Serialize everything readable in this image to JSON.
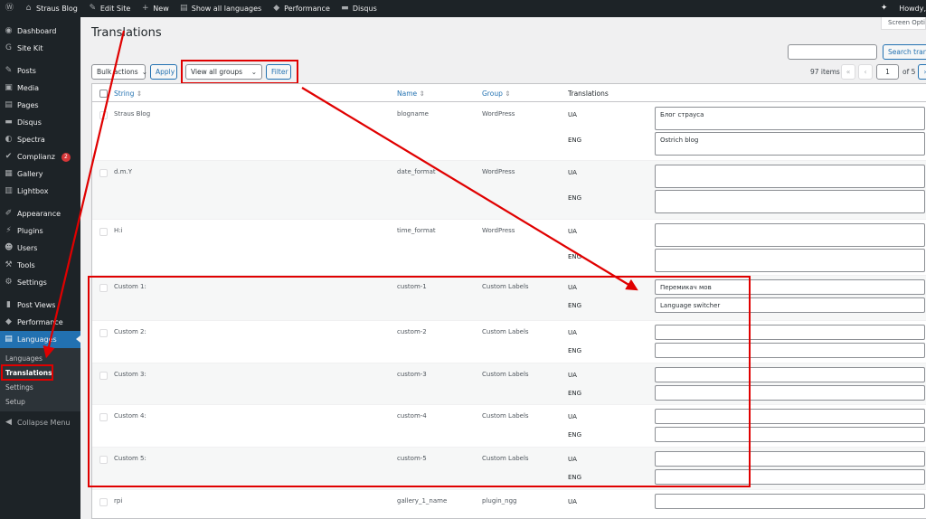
{
  "admin_bar": {
    "site_name": "Straus Blog",
    "edit_site": "Edit Site",
    "new": "New",
    "show_all_languages": "Show all languages",
    "performance": "Performance",
    "disqus": "Disqus",
    "howdy": "Howdy,"
  },
  "screen_options": "Screen Options",
  "sidebar": {
    "items": [
      {
        "label": "Dashboard",
        "icon": "dashboard-icon"
      },
      {
        "label": "Site Kit",
        "icon": "sitekit-icon"
      },
      {
        "label": "Posts",
        "icon": "pin-icon"
      },
      {
        "label": "Media",
        "icon": "media-icon"
      },
      {
        "label": "Pages",
        "icon": "page-icon"
      },
      {
        "label": "Disqus",
        "icon": "comment-icon"
      },
      {
        "label": "Spectra",
        "icon": "spectra-icon"
      },
      {
        "label": "Complianz",
        "icon": "check-icon",
        "badge": "2"
      },
      {
        "label": "Gallery",
        "icon": "gallery-icon"
      },
      {
        "label": "Lightbox",
        "icon": "lightbox-icon"
      },
      {
        "label": "Appearance",
        "icon": "brush-icon"
      },
      {
        "label": "Plugins",
        "icon": "plugin-icon"
      },
      {
        "label": "Users",
        "icon": "users-icon"
      },
      {
        "label": "Tools",
        "icon": "wrench-icon"
      },
      {
        "label": "Settings",
        "icon": "settings-icon"
      },
      {
        "label": "Post Views",
        "icon": "chart-icon"
      },
      {
        "label": "Performance",
        "icon": "performance-icon"
      },
      {
        "label": "Languages",
        "icon": "translate-icon"
      }
    ],
    "submenu": [
      "Languages",
      "Translations",
      "Settings",
      "Setup"
    ],
    "collapse": "Collapse Menu"
  },
  "page": {
    "title": "Translations",
    "search_button": "Search translations",
    "bulk_actions": "Bulk actions",
    "apply": "Apply",
    "groups_select": "View all groups",
    "filter": "Filter",
    "items_count": "97 items",
    "first_page": "«",
    "prev_page": "‹",
    "current_page": "1",
    "of_pages": "of 5",
    "next_page": "›"
  },
  "table": {
    "columns": {
      "string": "String",
      "name": "Name",
      "group": "Group",
      "translations": "Translations"
    },
    "rows": [
      {
        "string": "Straus Blog",
        "name": "blogname",
        "group": "WordPress",
        "ua": "Блог страуса",
        "eng": "Ostrich blog"
      },
      {
        "string": "d.m.Y",
        "name": "date_format",
        "group": "WordPress",
        "ua": "",
        "eng": ""
      },
      {
        "string": "H:i",
        "name": "time_format",
        "group": "WordPress",
        "ua": "",
        "eng": ""
      },
      {
        "string": "Custom 1:",
        "name": "custom-1",
        "group": "Custom Labels",
        "ua": "Перемикач мов",
        "eng": "Language switcher"
      },
      {
        "string": "Custom 2:",
        "name": "custom-2",
        "group": "Custom Labels",
        "ua": "",
        "eng": ""
      },
      {
        "string": "Custom 3:",
        "name": "custom-3",
        "group": "Custom Labels",
        "ua": "",
        "eng": ""
      },
      {
        "string": "Custom 4:",
        "name": "custom-4",
        "group": "Custom Labels",
        "ua": "",
        "eng": ""
      },
      {
        "string": "Custom 5:",
        "name": "custom-5",
        "group": "Custom Labels",
        "ua": "",
        "eng": ""
      },
      {
        "string": "rpi",
        "name": "gallery_1_name",
        "group": "plugin_ngg",
        "ua": "",
        "eng": ""
      }
    ],
    "lang_ua": "UA",
    "lang_eng": "ENG"
  },
  "colors": {
    "admin_dark": "#1d2327",
    "accent": "#2271b1",
    "annotation": "#e00000"
  }
}
